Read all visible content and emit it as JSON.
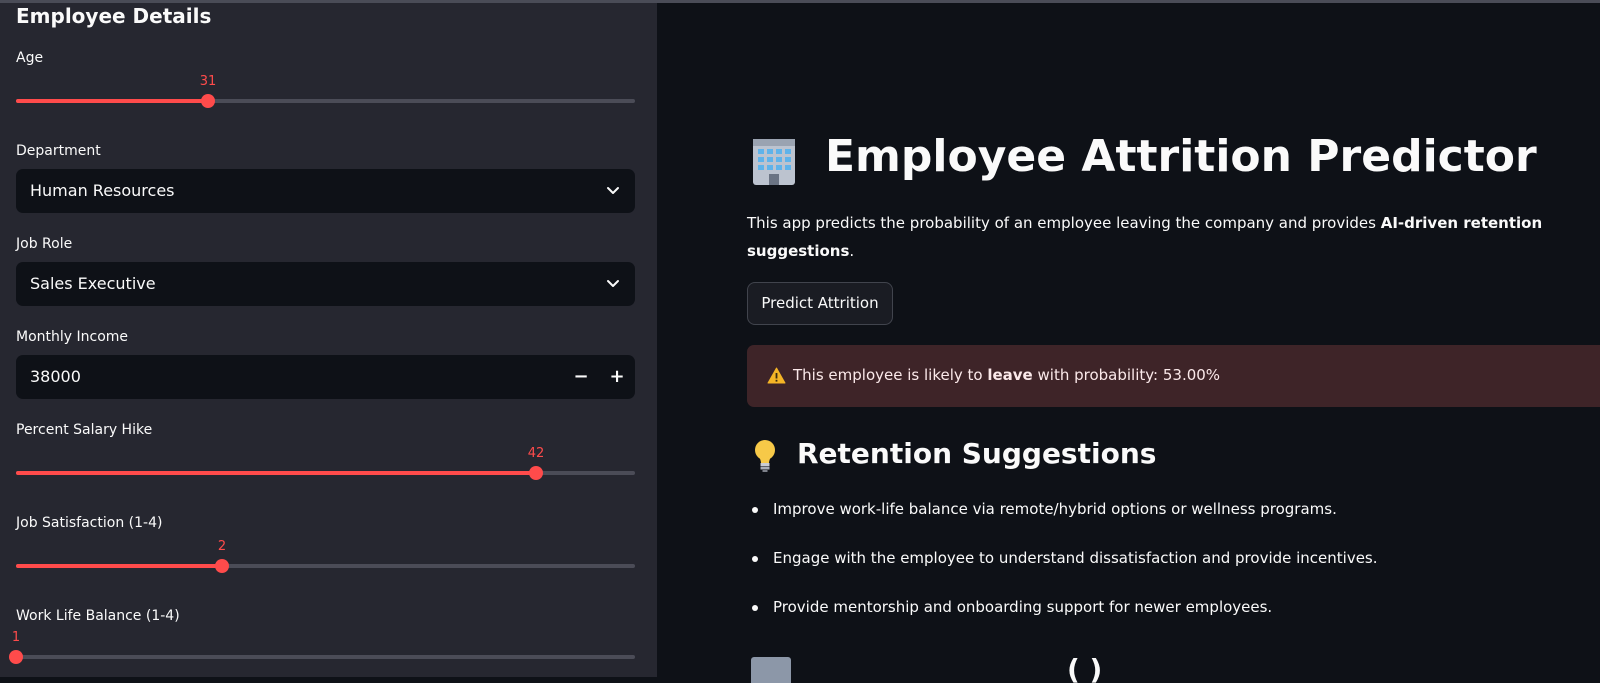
{
  "sidebar": {
    "title": "Employee Details",
    "age": {
      "label": "Age",
      "value": "31",
      "fraction": 0.31
    },
    "department": {
      "label": "Department",
      "value": "Human Resources"
    },
    "job_role": {
      "label": "Job Role",
      "value": "Sales Executive"
    },
    "monthly_income": {
      "label": "Monthly Income",
      "value": "38000",
      "minus": "−",
      "plus": "+"
    },
    "salary_hike": {
      "label": "Percent Salary Hike",
      "value": "42",
      "fraction": 0.84
    },
    "job_satisfaction": {
      "label": "Job Satisfaction (1-4)",
      "value": "2",
      "fraction": 0.333
    },
    "work_life_balance": {
      "label": "Work Life Balance (1-4)",
      "value": "1",
      "fraction": 0.0
    }
  },
  "main": {
    "title": "Employee Attrition Predictor",
    "description_pre": "This app predicts the probability of an employee leaving the company and provides ",
    "description_bold": "AI-driven retention suggestions",
    "description_post": ".",
    "predict_button": "Predict Attrition",
    "alert": {
      "pre": "This employee is likely to ",
      "bold": "leave",
      "post": " with probability: 53.00%"
    },
    "suggestions_title": "Retention Suggestions",
    "suggestions": [
      "Improve work-life balance via remote/hybrid options or wellness programs.",
      "Engage with the employee to understand dissatisfaction and provide incentives.",
      "Provide mentorship and onboarding support for newer employees."
    ],
    "partial_heading_tail": "(                  )"
  },
  "colors": {
    "accent": "#ff4b4b",
    "sidebar_bg": "#262730",
    "main_bg": "#0e1117",
    "alert_bg": "#3e2428"
  }
}
